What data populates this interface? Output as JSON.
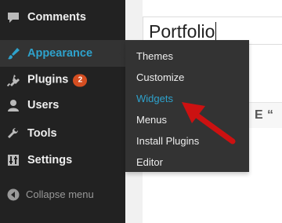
{
  "sidebar": {
    "items": [
      {
        "label": "Comments",
        "icon": "comments-icon"
      },
      {
        "label": "Appearance",
        "icon": "appearance-brush-icon",
        "active": true
      },
      {
        "label": "Plugins",
        "icon": "plugins-icon",
        "badge": "2"
      },
      {
        "label": "Users",
        "icon": "users-icon"
      },
      {
        "label": "Tools",
        "icon": "tools-wrench-icon"
      },
      {
        "label": "Settings",
        "icon": "settings-icon"
      }
    ],
    "collapse_label": "Collapse menu"
  },
  "submenu": {
    "items": [
      {
        "label": "Themes"
      },
      {
        "label": "Customize"
      },
      {
        "label": "Widgets",
        "highlighted": true
      },
      {
        "label": "Menus"
      },
      {
        "label": "Install Plugins"
      },
      {
        "label": "Editor"
      }
    ]
  },
  "editor": {
    "title_value": "Portfolio",
    "toolbar_glyphs": [
      "E",
      "“"
    ]
  },
  "colors": {
    "sidebar_bg": "#222222",
    "active_text": "#2ea2cc",
    "badge_bg": "#d54e21",
    "annotation_arrow": "#cc1111"
  }
}
